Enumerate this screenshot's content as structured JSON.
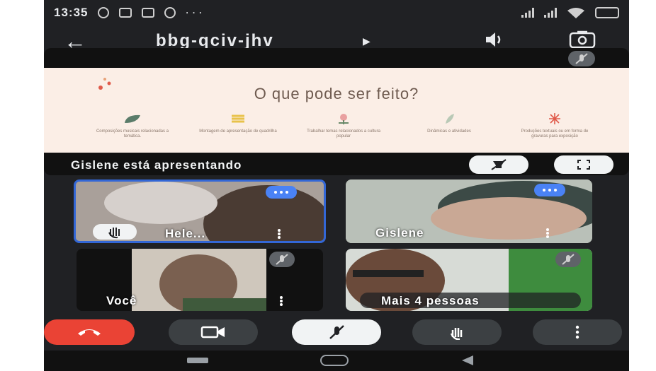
{
  "status": {
    "time": "13:35",
    "more": "· · ·"
  },
  "appbar": {
    "meeting_code": "bbg-qciv-jhv",
    "back_icon": "arrow-left-icon",
    "speaker_icon": "speaker-icon",
    "switch_camera_icon": "switch-camera-icon"
  },
  "presentation": {
    "slide_title": "O que pode ser feito?",
    "items": [
      {
        "label": "Composições musicais relacionadas a temática.",
        "icon": "leaf-icon",
        "color": "#5b7c6a"
      },
      {
        "label": "Montagem de apresentação de quadrilha",
        "icon": "wheat-icon",
        "color": "#e8c24a"
      },
      {
        "label": "Trabalhar temas relacionados a cultura popular",
        "icon": "flower-icon",
        "color": "#e9a0a0"
      },
      {
        "label": "Dinâmicas e atividades",
        "icon": "feather-icon",
        "color": "#b9c9b6"
      },
      {
        "label": "Produções textuais ou em forma de gravuras para exposição",
        "icon": "sun-icon",
        "color": "#e05a4a"
      }
    ],
    "presenter_text": "Gislene está apresentando"
  },
  "participants": [
    {
      "name": "Hele...",
      "state": "speaking"
    },
    {
      "name": "Gislene",
      "state": "speaking"
    },
    {
      "name": "Você",
      "state": "muted"
    },
    {
      "name": "Mais 4 pessoas",
      "state": "muted"
    }
  ],
  "colors": {
    "accent_blue": "#3367d6",
    "end_call_red": "#ea4335",
    "background": "#202124"
  }
}
